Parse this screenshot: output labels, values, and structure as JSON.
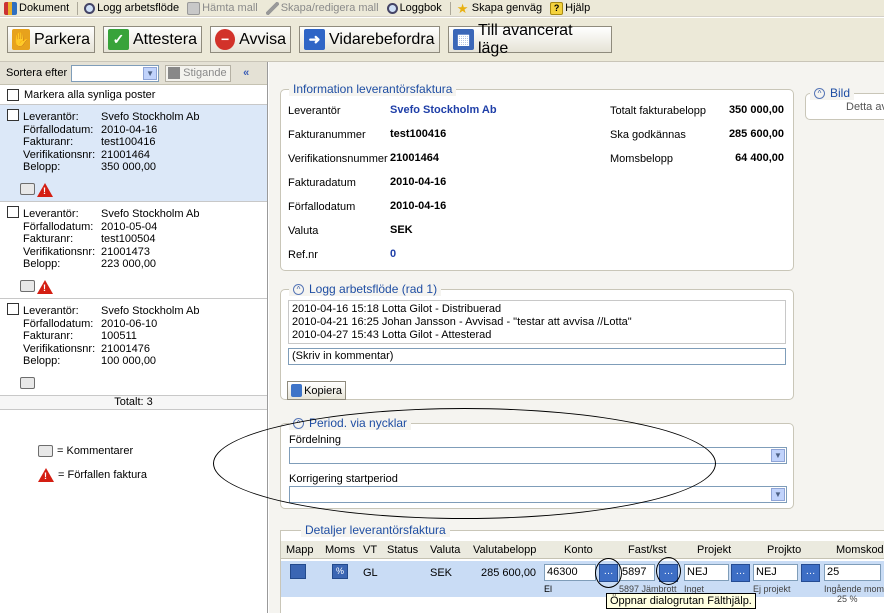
{
  "menu": [
    {
      "label": "Dokument",
      "icon": "library-icon",
      "enabled": true
    },
    {
      "label": "Logg arbetsflöde",
      "icon": "magnifier-icon",
      "enabled": true
    },
    {
      "label": "Hämta mall",
      "icon": "template-icon",
      "enabled": false
    },
    {
      "label": "Skapa/redigera mall",
      "icon": "pen-icon",
      "enabled": false
    },
    {
      "label": "Loggbok",
      "icon": "magnifier-icon",
      "enabled": true
    },
    {
      "label": "Skapa genväg",
      "icon": "star-icon",
      "enabled": true
    },
    {
      "label": "Hjälp",
      "icon": "help-icon",
      "enabled": true
    }
  ],
  "toolbar": {
    "parkera": "Parkera",
    "attestera": "Attestera",
    "avvisa": "Avvisa",
    "vidarebefordra": "Vidarebefordra",
    "avancerat": "Till avancerat läge"
  },
  "left": {
    "sort_label": "Sortera efter",
    "sort_value": "",
    "sort_dir": "Stigande",
    "mark_all": "Markera alla synliga poster",
    "invoices": [
      {
        "leverantor": "Svefo Stockholm Ab",
        "forfallodatum": "2010-04-16",
        "fakturanr": "test100416",
        "verifikationsnr": "21001464",
        "belopp": "350 000,00",
        "selected": true,
        "overdue": true
      },
      {
        "leverantor": "Svefo Stockholm Ab",
        "forfallodatum": "2010-05-04",
        "fakturanr": "test100504",
        "verifikationsnr": "21001473",
        "belopp": "223 000,00",
        "selected": false,
        "overdue": true
      },
      {
        "leverantor": "Svefo Stockholm Ab",
        "forfallodatum": "2010-06-10",
        "fakturanr": "100511",
        "verifikationsnr": "21001476",
        "belopp": "100 000,00",
        "selected": false,
        "overdue": false
      }
    ],
    "field_labels": {
      "leverantor": "Leverantör:",
      "forfallodatum": "Förfallodatum:",
      "fakturanr": "Fakturanr:",
      "verifikationsnr": "Verifikationsnr:",
      "belopp": "Belopp:"
    },
    "total": "Totalt: 3",
    "legend_comments": "= Kommentarer",
    "legend_overdue": "= Förfallen faktura"
  },
  "info": {
    "title": "Information leverantörsfaktura",
    "leverantor_label": "Leverantör",
    "leverantor": "Svefo Stockholm Ab",
    "fakturanummer_label": "Fakturanummer",
    "fakturanummer": "test100416",
    "verifikationsnummer_label": "Verifikationsnummer",
    "verifikationsnummer": "21001464",
    "fakturadatum_label": "Fakturadatum",
    "fakturadatum": "2010-04-16",
    "forfallodatum_label": "Förfallodatum",
    "forfallodatum": "2010-04-16",
    "valuta_label": "Valuta",
    "valuta": "SEK",
    "refnr_label": "Ref.nr",
    "refnr": "0",
    "totalt_label": "Totalt fakturabelopp",
    "totalt": "350 000,00",
    "godkannas_label": "Ska godkännas",
    "godkannas": "285 600,00",
    "moms_label": "Momsbelopp",
    "moms": "64 400,00"
  },
  "bild": {
    "title": "Bild",
    "text": "Detta av"
  },
  "log": {
    "title": "Logg arbetsflöde (rad 1)",
    "entries": [
      "2010-04-16 15:18 Lotta Gilot - Distribuerad",
      "2010-04-21 16:25 Johan Jansson - Avvisad - \"testar att avvisa //Lotta\"",
      "2010-04-27 15:43 Lotta Gilot - Attesterad"
    ],
    "comment_placeholder": "(Skriv in kommentar)",
    "copy_label": "Kopiera"
  },
  "period": {
    "title": "Period. via nycklar",
    "fordelning_label": "Fördelning",
    "fordelning_value": "",
    "korrigering_label": "Korrigering startperiod",
    "korrigering_value": ""
  },
  "details": {
    "title": "Detaljer leverantörsfaktura",
    "headers": [
      "Mapp",
      "Moms",
      "VT",
      "Status",
      "Valuta",
      "Valutabelopp",
      "Konto",
      "Fast/kst",
      "Projekt",
      "Projkto",
      "Momskod"
    ],
    "row": {
      "vt": "GL",
      "valuta": "SEK",
      "valutabelopp": "285 600,00",
      "konto": "46300",
      "konto_desc": "El",
      "fastkst": "5897",
      "fastkst_desc": "5897 Jämbrott",
      "projekt": "NEJ",
      "projekt_desc": "Inget",
      "projkto": "NEJ",
      "projkto_desc": "Ej projekt",
      "momskod": "25",
      "momskod_desc": "Ingående mom",
      "momskod_desc2": "25 %"
    },
    "tooltip": "Öppnar dialogrutan Fälthjälp."
  }
}
